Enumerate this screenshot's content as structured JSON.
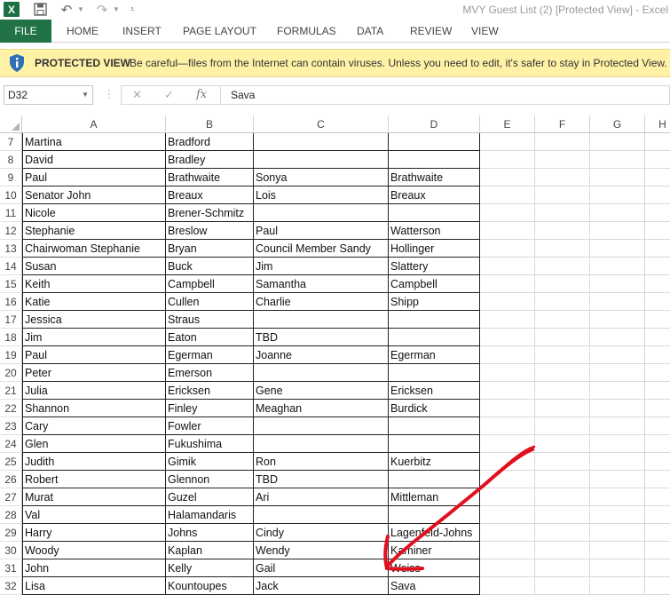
{
  "app": {
    "logo_letter": "X",
    "window_title": "MVY Guest List (2)  [Protected View] - Excel"
  },
  "ribbon": {
    "tabs": [
      "FILE",
      "HOME",
      "INSERT",
      "PAGE LAYOUT",
      "FORMULAS",
      "DATA",
      "REVIEW",
      "VIEW"
    ]
  },
  "protected_view": {
    "title": "PROTECTED VIEW",
    "message": "Be careful—files from the Internet can contain viruses. Unless you need to edit, it's safer to stay in Protected View."
  },
  "formula_bar": {
    "name_box": "D32",
    "fx_label": "fx",
    "content": "Sava"
  },
  "sheet": {
    "columns": [
      "A",
      "B",
      "C",
      "D",
      "E",
      "F",
      "G",
      "H"
    ],
    "rows": [
      {
        "num": "7",
        "cells": [
          "Martina",
          "Bradford",
          "",
          ""
        ]
      },
      {
        "num": "8",
        "cells": [
          "David",
          "Bradley",
          "",
          ""
        ]
      },
      {
        "num": "9",
        "cells": [
          "Paul",
          "Brathwaite",
          "Sonya",
          "Brathwaite"
        ]
      },
      {
        "num": "10",
        "cells": [
          "Senator John",
          "Breaux",
          "Lois",
          "Breaux"
        ]
      },
      {
        "num": "11",
        "cells": [
          "Nicole",
          "Brener-Schmitz",
          "",
          ""
        ]
      },
      {
        "num": "12",
        "cells": [
          "Stephanie",
          "Breslow",
          "Paul",
          "Watterson"
        ]
      },
      {
        "num": "13",
        "cells": [
          "Chairwoman Stephanie",
          "Bryan",
          "Council Member Sandy",
          "Hollinger"
        ]
      },
      {
        "num": "14",
        "cells": [
          "Susan",
          "Buck",
          "Jim",
          "Slattery"
        ]
      },
      {
        "num": "15",
        "cells": [
          "Keith",
          "Campbell",
          "Samantha",
          "Campbell"
        ]
      },
      {
        "num": "16",
        "cells": [
          "Katie",
          "Cullen",
          "Charlie",
          "Shipp"
        ]
      },
      {
        "num": "17",
        "cells": [
          "Jessica",
          "Straus",
          "",
          ""
        ]
      },
      {
        "num": "18",
        "cells": [
          "Jim",
          "Eaton",
          "TBD",
          ""
        ]
      },
      {
        "num": "19",
        "cells": [
          "Paul",
          "Egerman",
          "Joanne",
          "Egerman"
        ]
      },
      {
        "num": "20",
        "cells": [
          "Peter",
          "Emerson",
          "",
          ""
        ]
      },
      {
        "num": "21",
        "cells": [
          "Julia",
          "Ericksen",
          "Gene",
          "Ericksen"
        ]
      },
      {
        "num": "22",
        "cells": [
          "Shannon",
          "Finley",
          "Meaghan",
          "Burdick"
        ]
      },
      {
        "num": "23",
        "cells": [
          "Cary",
          "Fowler",
          "",
          ""
        ]
      },
      {
        "num": "24",
        "cells": [
          "Glen",
          "Fukushima",
          "",
          ""
        ]
      },
      {
        "num": "25",
        "cells": [
          "Judith",
          "Gimik",
          "Ron",
          "Kuerbitz"
        ]
      },
      {
        "num": "26",
        "cells": [
          "Robert",
          "Glennon",
          "TBD",
          ""
        ]
      },
      {
        "num": "27",
        "cells": [
          "Murat",
          "Guzel",
          "Ari",
          "Mittleman"
        ]
      },
      {
        "num": "28",
        "cells": [
          "Val",
          "Halamandaris",
          "",
          ""
        ]
      },
      {
        "num": "29",
        "cells": [
          "Harry",
          "Johns",
          "Cindy",
          "Lagenfeld-Johns"
        ]
      },
      {
        "num": "30",
        "cells": [
          "Woody",
          "Kaplan",
          "Wendy",
          "Kaminer"
        ]
      },
      {
        "num": "31",
        "cells": [
          "John",
          "Kelly",
          "Gail",
          "Weiss"
        ]
      },
      {
        "num": "32",
        "cells": [
          "Lisa",
          "Kountoupes",
          "Jack",
          "Sava"
        ]
      }
    ]
  },
  "colors": {
    "file_tab": "#217346",
    "protected_bar": "#fff1a6",
    "annotation_arrow": "#e0101e"
  }
}
